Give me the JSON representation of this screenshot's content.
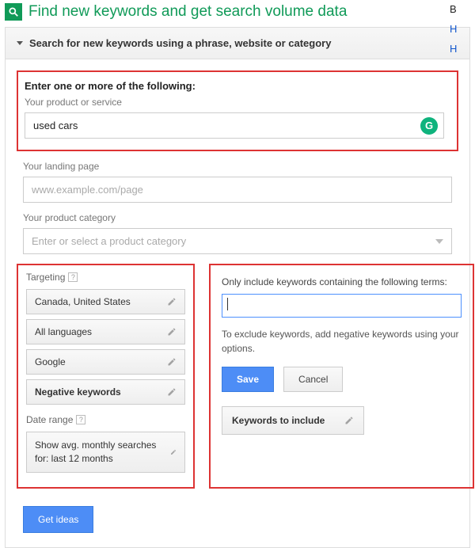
{
  "header": {
    "title": "Find new keywords and get search volume data"
  },
  "right": {
    "r1": "B",
    "r2": "H",
    "r3": "H"
  },
  "panel": {
    "head": "Search for new keywords using a phrase, website or category"
  },
  "section": {
    "title": "Enter one or more of the following:",
    "product_label": "Your product or service",
    "product_value": "used cars",
    "g_badge": "G",
    "landing_label": "Your landing page",
    "landing_placeholder": "www.example.com/page",
    "category_label": "Your product category",
    "category_placeholder": "Enter or select a product category"
  },
  "targeting": {
    "title": "Targeting",
    "help": "?",
    "items": [
      {
        "label": "Canada, United States"
      },
      {
        "label": "All languages"
      },
      {
        "label": "Google"
      },
      {
        "label": "Negative keywords",
        "bold": true
      }
    ],
    "date_title": "Date range",
    "date_value": "Show avg. monthly searches for: last 12 months"
  },
  "filter": {
    "label": "Only include keywords containing the following terms:",
    "hint": "To exclude keywords, add negative keywords using your options.",
    "save": "Save",
    "cancel": "Cancel",
    "include": "Keywords to include"
  },
  "cta": {
    "get_ideas": "Get ideas"
  }
}
